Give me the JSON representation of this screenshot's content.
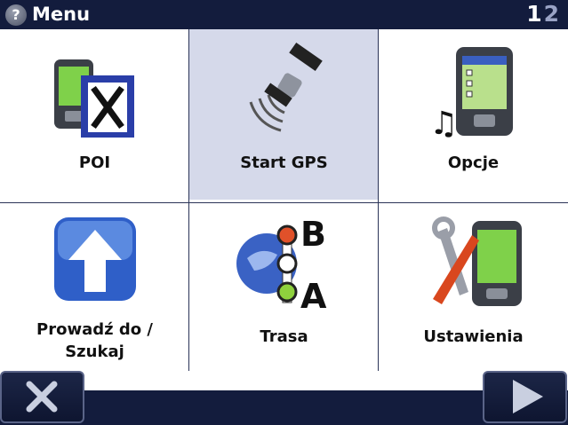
{
  "header": {
    "title": "Menu",
    "page_current": "1",
    "page_other": "2"
  },
  "menu": {
    "poi": "POI",
    "start_gps": "Start GPS",
    "opcje": "Opcje",
    "prowadz_line1": "Prowadź do /",
    "prowadz_line2": "Szukaj",
    "trasa": "Trasa",
    "ustawienia": "Ustawienia"
  },
  "icons": {
    "help": "help-icon",
    "close": "close-icon",
    "next": "arrow-right-icon"
  },
  "colors": {
    "bar": "#131c3d",
    "selected_tile": "#d5d9ea"
  }
}
